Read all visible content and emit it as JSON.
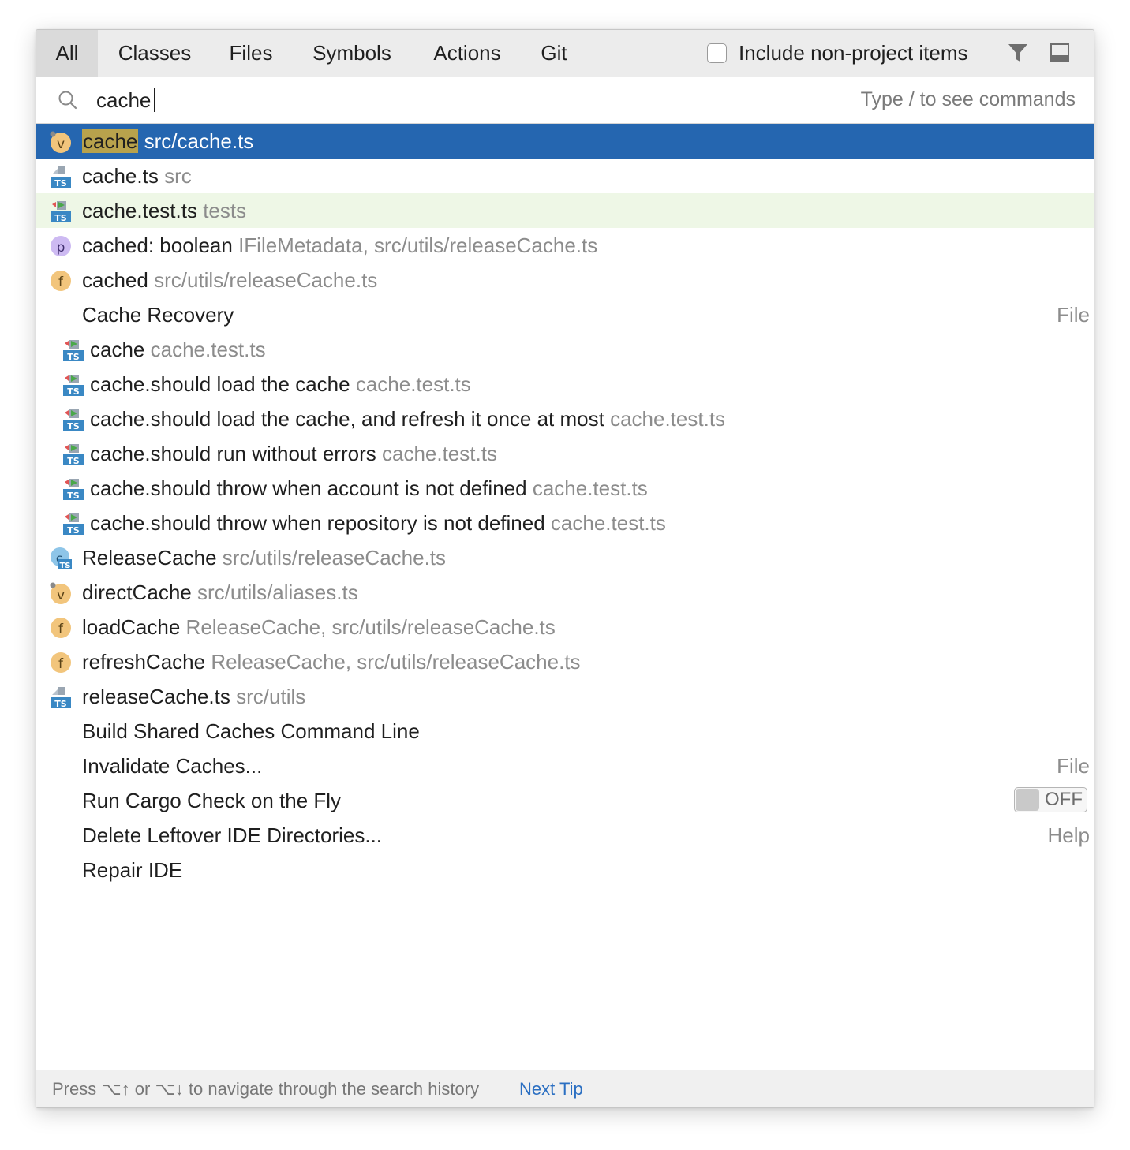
{
  "tabs": [
    {
      "label": "All",
      "active": true
    },
    {
      "label": "Classes",
      "active": false
    },
    {
      "label": "Files",
      "active": false
    },
    {
      "label": "Symbols",
      "active": false
    },
    {
      "label": "Actions",
      "active": false
    },
    {
      "label": "Git",
      "active": false
    }
  ],
  "include_non_project": {
    "label": "Include non-project items",
    "checked": false
  },
  "toolbar_icons": [
    "filter-icon",
    "preview-panel-icon"
  ],
  "search": {
    "value": "cache",
    "hint": "Type / to see commands"
  },
  "results": [
    {
      "icon": "variable-icon",
      "name": "cache",
      "location": "src/cache.ts",
      "selected": true
    },
    {
      "icon": "ts-file-icon",
      "name": "cache.ts",
      "location": "src"
    },
    {
      "icon": "ts-test-file-icon",
      "name": "cache.test.ts",
      "location": "tests"
    },
    {
      "icon": "property-icon",
      "name": "cached: boolean",
      "location": "IFileMetadata, src/utils/releaseCache.ts"
    },
    {
      "icon": "function-icon",
      "name": "cached",
      "location": "src/utils/releaseCache.ts"
    },
    {
      "icon": "",
      "name": "Cache Recovery",
      "location": "",
      "right": "File"
    },
    {
      "icon": "ts-test-file-icon",
      "name": "cache",
      "location": "cache.test.ts"
    },
    {
      "icon": "ts-test-file-icon",
      "name": "cache.should load the cache",
      "location": "cache.test.ts"
    },
    {
      "icon": "ts-test-file-icon",
      "name": "cache.should load the cache, and refresh it once at most",
      "location": "cache.test.ts"
    },
    {
      "icon": "ts-test-file-icon",
      "name": "cache.should run without errors",
      "location": "cache.test.ts"
    },
    {
      "icon": "ts-test-file-icon",
      "name": "cache.should throw when account is not defined",
      "location": "cache.test.ts"
    },
    {
      "icon": "ts-test-file-icon",
      "name": "cache.should throw when repository is not defined",
      "location": "cache.test.ts"
    },
    {
      "icon": "ts-class-icon",
      "name": "ReleaseCache",
      "location": "src/utils/releaseCache.ts"
    },
    {
      "icon": "variable-icon",
      "name": "directCache",
      "location": "src/utils/aliases.ts"
    },
    {
      "icon": "function-icon",
      "name": "loadCache",
      "location": "ReleaseCache, src/utils/releaseCache.ts"
    },
    {
      "icon": "function-icon",
      "name": "refreshCache",
      "location": "ReleaseCache, src/utils/releaseCache.ts"
    },
    {
      "icon": "ts-file-icon",
      "name": "releaseCache.ts",
      "location": "src/utils"
    },
    {
      "icon": "",
      "name": "Build Shared Caches Command Line",
      "location": ""
    },
    {
      "icon": "",
      "name": "Invalidate Caches...",
      "location": "",
      "right": "File"
    },
    {
      "icon": "",
      "name": "Run Cargo Check on the Fly",
      "location": "",
      "toggle": "OFF"
    },
    {
      "icon": "",
      "name": "Delete Leftover IDE Directories...",
      "location": "",
      "right": "Help"
    },
    {
      "icon": "",
      "name": "Repair IDE",
      "location": ""
    }
  ],
  "footer": {
    "text": "Press ⌥↑ or ⌥↓ to navigate through the search history",
    "link": "Next Tip"
  },
  "colors": {
    "selection": "#2566b0",
    "test_row": "#eef7e6",
    "match_highlight": "#b8a24c",
    "link": "#2b6fc2"
  }
}
